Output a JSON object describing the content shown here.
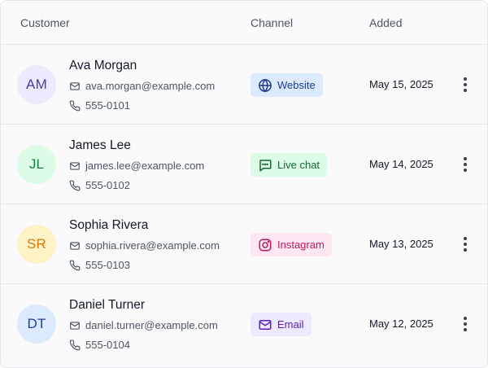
{
  "header": {
    "customer": "Customer",
    "channel": "Channel",
    "added": "Added"
  },
  "rows": [
    {
      "initials": "AM",
      "name": "Ava Morgan",
      "email": "ava.morgan@example.com",
      "phone": "555-0101",
      "channel": "Website",
      "channel_icon": "globe-icon",
      "added": "May 15, 2025",
      "avatar_bg": "#ede9fe",
      "avatar_fg": "#4c3ba8",
      "badge_bg": "#dbeafe",
      "badge_fg": "#1e3a8a"
    },
    {
      "initials": "JL",
      "name": "James Lee",
      "email": "james.lee@example.com",
      "phone": "555-0102",
      "channel": "Live chat",
      "channel_icon": "chat-icon",
      "added": "May 14, 2025",
      "avatar_bg": "#dcfce7",
      "avatar_fg": "#15803d",
      "badge_bg": "#dcfce7",
      "badge_fg": "#166534"
    },
    {
      "initials": "SR",
      "name": "Sophia Rivera",
      "email": "sophia.rivera@example.com",
      "phone": "555-0103",
      "channel": "Instagram",
      "channel_icon": "instagram-icon",
      "added": "May 13, 2025",
      "avatar_bg": "#fef3c7",
      "avatar_fg": "#d97706",
      "badge_bg": "#fce7f3",
      "badge_fg": "#be185d"
    },
    {
      "initials": "DT",
      "name": "Daniel Turner",
      "email": "daniel.turner@example.com",
      "phone": "555-0104",
      "channel": "Email",
      "channel_icon": "mail-icon",
      "added": "May 12, 2025",
      "avatar_bg": "#dbeafe",
      "avatar_fg": "#1e40af",
      "badge_bg": "#ede9fe",
      "badge_fg": "#5b21b6"
    }
  ]
}
